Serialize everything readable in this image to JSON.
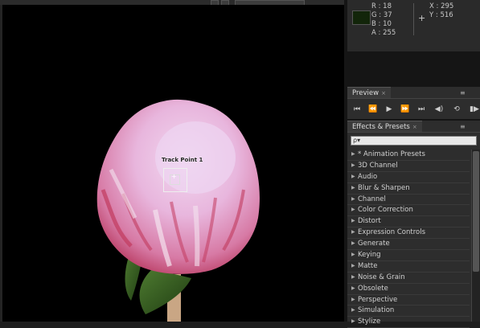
{
  "info": {
    "r": "R : 18",
    "g": "G : 37",
    "b": "B : 10",
    "a": "A : 255",
    "x": "X : 295",
    "y": "Y : 516",
    "swatch_color": "#12250a"
  },
  "viewer": {
    "track_point_label": "Track Point 1"
  },
  "preview": {
    "tab_label": "Preview",
    "close": "×",
    "menu": "≡",
    "controls": [
      "first-frame-icon",
      "prev-frame-icon",
      "play-icon",
      "next-frame-icon",
      "last-frame-icon",
      "audio-icon",
      "loop-icon",
      "ram-preview-icon"
    ]
  },
  "effects": {
    "tab_label": "Effects & Presets",
    "close": "×",
    "menu": "≡",
    "search_icon": "ρ▾",
    "items": [
      "* Animation Presets",
      "3D Channel",
      "Audio",
      "Blur & Sharpen",
      "Channel",
      "Color Correction",
      "Distort",
      "Expression Controls",
      "Generate",
      "Keying",
      "Matte",
      "Noise & Grain",
      "Obsolete",
      "Perspective",
      "Simulation",
      "Stylize"
    ]
  }
}
